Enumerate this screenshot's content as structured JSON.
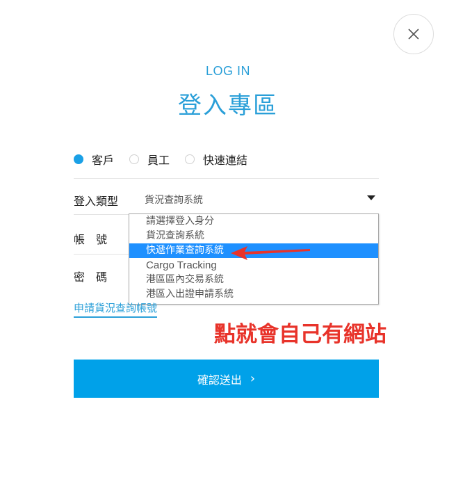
{
  "header": {
    "subtitle": "LOG IN",
    "title": "登入專區"
  },
  "close_icon": "close-icon",
  "login_options": [
    {
      "label": "客戶",
      "checked": true
    },
    {
      "label": "員工",
      "checked": false
    },
    {
      "label": "快速連結",
      "checked": false
    }
  ],
  "form": {
    "login_type_label": "登入類型",
    "login_type_value": "貨況查詢系統",
    "account_label": "帳　號",
    "password_label": "密　碼",
    "apply_link": "申請貨況查詢帳號"
  },
  "dropdown": {
    "options": [
      "請選擇登入身分",
      "貨況查詢系統",
      "快遞作業查詢系統",
      "Cargo Tracking",
      "港區區內交易系統",
      "港區入出證申請系統"
    ],
    "highlighted_index": 2
  },
  "annotation": "點就會自己有網站",
  "submit": {
    "label": "確認送出",
    "chevron": "›"
  },
  "colors": {
    "accent": "#2a9fd8",
    "button": "#00a1e9",
    "highlight": "#1e90ff",
    "annotation": "#e8332a"
  }
}
